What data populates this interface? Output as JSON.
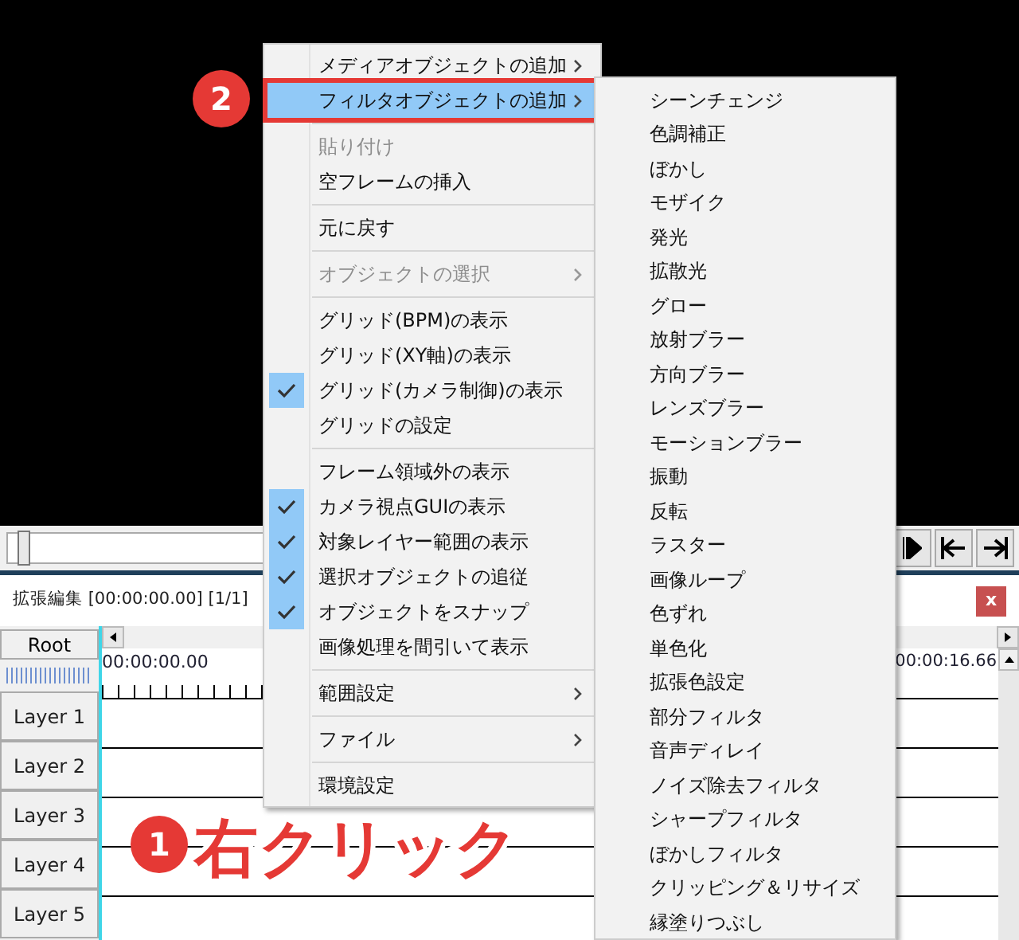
{
  "timeline": {
    "title": "拡張編集 [00:00:00.00] [1/1]",
    "close": "x",
    "root": "Root",
    "start_time": "00:00:00.00",
    "end_time": "00:00:16.66",
    "layers": [
      "Layer 1",
      "Layer 2",
      "Layer 3",
      "Layer 4",
      "Layer 5"
    ]
  },
  "slider": {
    "level": 0.0
  },
  "context_menu": [
    {
      "kind": "item",
      "label": "メディアオブジェクトの追加",
      "submenu": true,
      "disabled": false,
      "checked": false,
      "selected": false
    },
    {
      "kind": "item",
      "label": "フィルタオブジェクトの追加",
      "submenu": true,
      "disabled": false,
      "checked": false,
      "selected": true
    },
    {
      "kind": "separator"
    },
    {
      "kind": "item",
      "label": "貼り付け",
      "submenu": false,
      "disabled": true,
      "checked": false,
      "selected": false
    },
    {
      "kind": "item",
      "label": "空フレームの挿入",
      "submenu": false,
      "disabled": false,
      "checked": false,
      "selected": false
    },
    {
      "kind": "separator"
    },
    {
      "kind": "item",
      "label": "元に戻す",
      "submenu": false,
      "disabled": false,
      "checked": false,
      "selected": false
    },
    {
      "kind": "separator"
    },
    {
      "kind": "item",
      "label": "オブジェクトの選択",
      "submenu": true,
      "disabled": true,
      "checked": false,
      "selected": false
    },
    {
      "kind": "separator"
    },
    {
      "kind": "item",
      "label": "グリッド(BPM)の表示",
      "submenu": false,
      "disabled": false,
      "checked": false,
      "selected": false
    },
    {
      "kind": "item",
      "label": "グリッド(XY軸)の表示",
      "submenu": false,
      "disabled": false,
      "checked": false,
      "selected": false
    },
    {
      "kind": "item",
      "label": "グリッド(カメラ制御)の表示",
      "submenu": false,
      "disabled": false,
      "checked": true,
      "selected": false
    },
    {
      "kind": "item",
      "label": "グリッドの設定",
      "submenu": false,
      "disabled": false,
      "checked": false,
      "selected": false
    },
    {
      "kind": "separator"
    },
    {
      "kind": "item",
      "label": "フレーム領域外の表示",
      "submenu": false,
      "disabled": false,
      "checked": false,
      "selected": false
    },
    {
      "kind": "item",
      "label": "カメラ視点GUIの表示",
      "submenu": false,
      "disabled": false,
      "checked": true,
      "selected": false
    },
    {
      "kind": "item",
      "label": "対象レイヤー範囲の表示",
      "submenu": false,
      "disabled": false,
      "checked": true,
      "selected": false
    },
    {
      "kind": "item",
      "label": "選択オブジェクトの追従",
      "submenu": false,
      "disabled": false,
      "checked": true,
      "selected": false
    },
    {
      "kind": "item",
      "label": "オブジェクトをスナップ",
      "submenu": false,
      "disabled": false,
      "checked": true,
      "selected": false
    },
    {
      "kind": "item",
      "label": "画像処理を間引いて表示",
      "submenu": false,
      "disabled": false,
      "checked": false,
      "selected": false
    },
    {
      "kind": "separator"
    },
    {
      "kind": "item",
      "label": "範囲設定",
      "submenu": true,
      "disabled": false,
      "checked": false,
      "selected": false
    },
    {
      "kind": "separator"
    },
    {
      "kind": "item",
      "label": "ファイル",
      "submenu": true,
      "disabled": false,
      "checked": false,
      "selected": false
    },
    {
      "kind": "separator"
    },
    {
      "kind": "item",
      "label": "環境設定",
      "submenu": false,
      "disabled": false,
      "checked": false,
      "selected": false
    }
  ],
  "filter_submenu": [
    "シーンチェンジ",
    "色調補正",
    "ぼかし",
    "モザイク",
    "発光",
    "拡散光",
    "グロー",
    "放射ブラー",
    "方向ブラー",
    "レンズブラー",
    "モーションブラー",
    "振動",
    "反転",
    "ラスター",
    "画像ループ",
    "色ずれ",
    "単色化",
    "拡張色設定",
    "部分フィルタ",
    "音声ディレイ",
    "ノイズ除去フィルタ",
    "シャープフィルタ",
    "ぼかしフィルタ",
    "クリッピング＆リサイズ",
    "縁塗りつぶし"
  ],
  "annotations": [
    {
      "number": "2"
    },
    {
      "number": "1",
      "text": "右クリック"
    }
  ]
}
